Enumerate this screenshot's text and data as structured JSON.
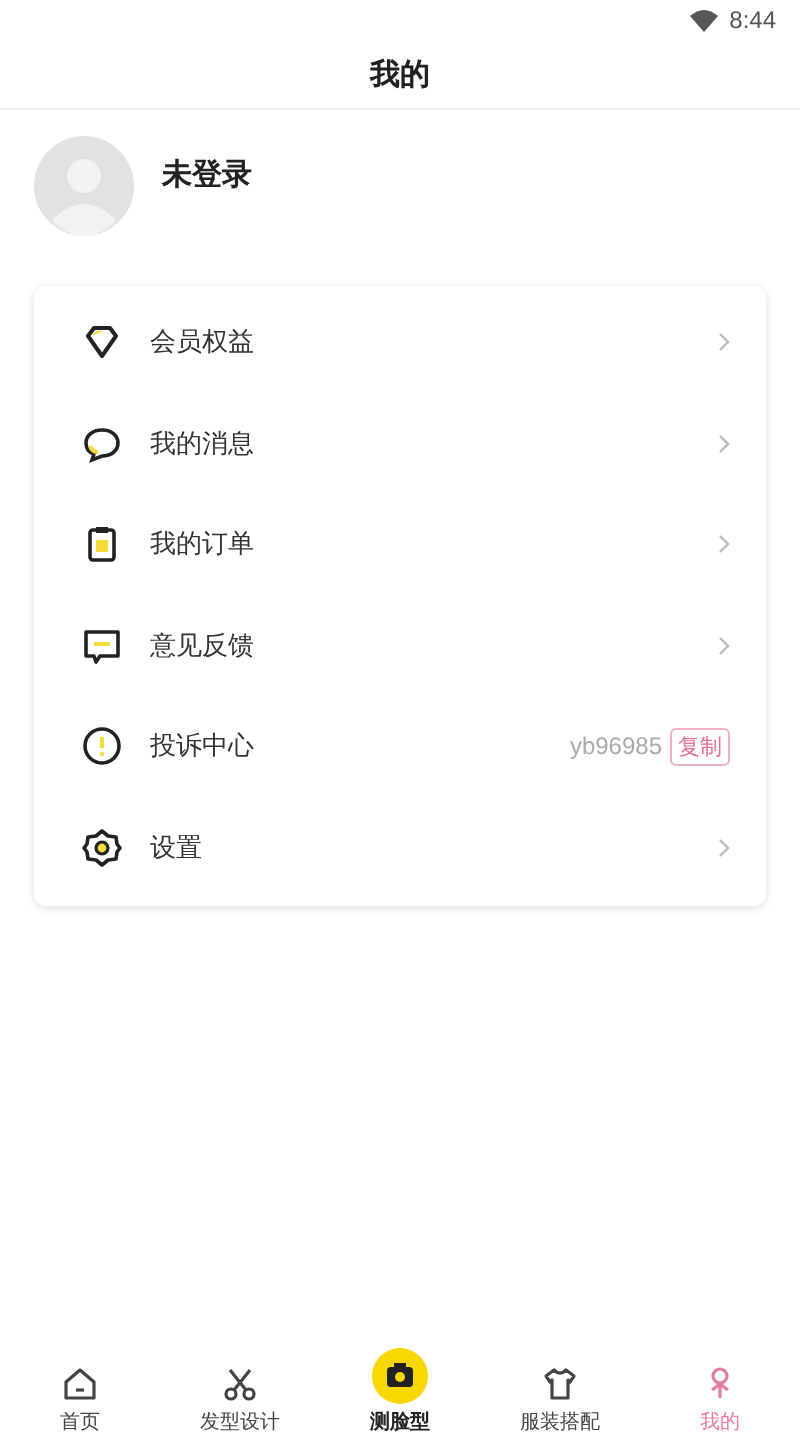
{
  "status_bar": {
    "time": "8:44"
  },
  "header": {
    "title": "我的"
  },
  "profile": {
    "name": "未登录"
  },
  "menu": [
    {
      "kind": "link",
      "label": "会员权益"
    },
    {
      "kind": "link",
      "label": "我的消息"
    },
    {
      "kind": "link",
      "label": "我的订单"
    },
    {
      "kind": "link",
      "label": "意见反馈"
    },
    {
      "kind": "copy",
      "label": "投诉中心",
      "value": "yb96985",
      "action": "复制"
    },
    {
      "kind": "link",
      "label": "设置"
    }
  ],
  "tab_bar": [
    {
      "kind": "plain",
      "label": "首页",
      "selected": false
    },
    {
      "kind": "plain",
      "label": "发型设计",
      "selected": false
    },
    {
      "kind": "raised",
      "label": "测脸型",
      "selected": false
    },
    {
      "kind": "plain",
      "label": "服装搭配",
      "selected": false
    },
    {
      "kind": "plain",
      "label": "我的",
      "selected": true
    }
  ]
}
